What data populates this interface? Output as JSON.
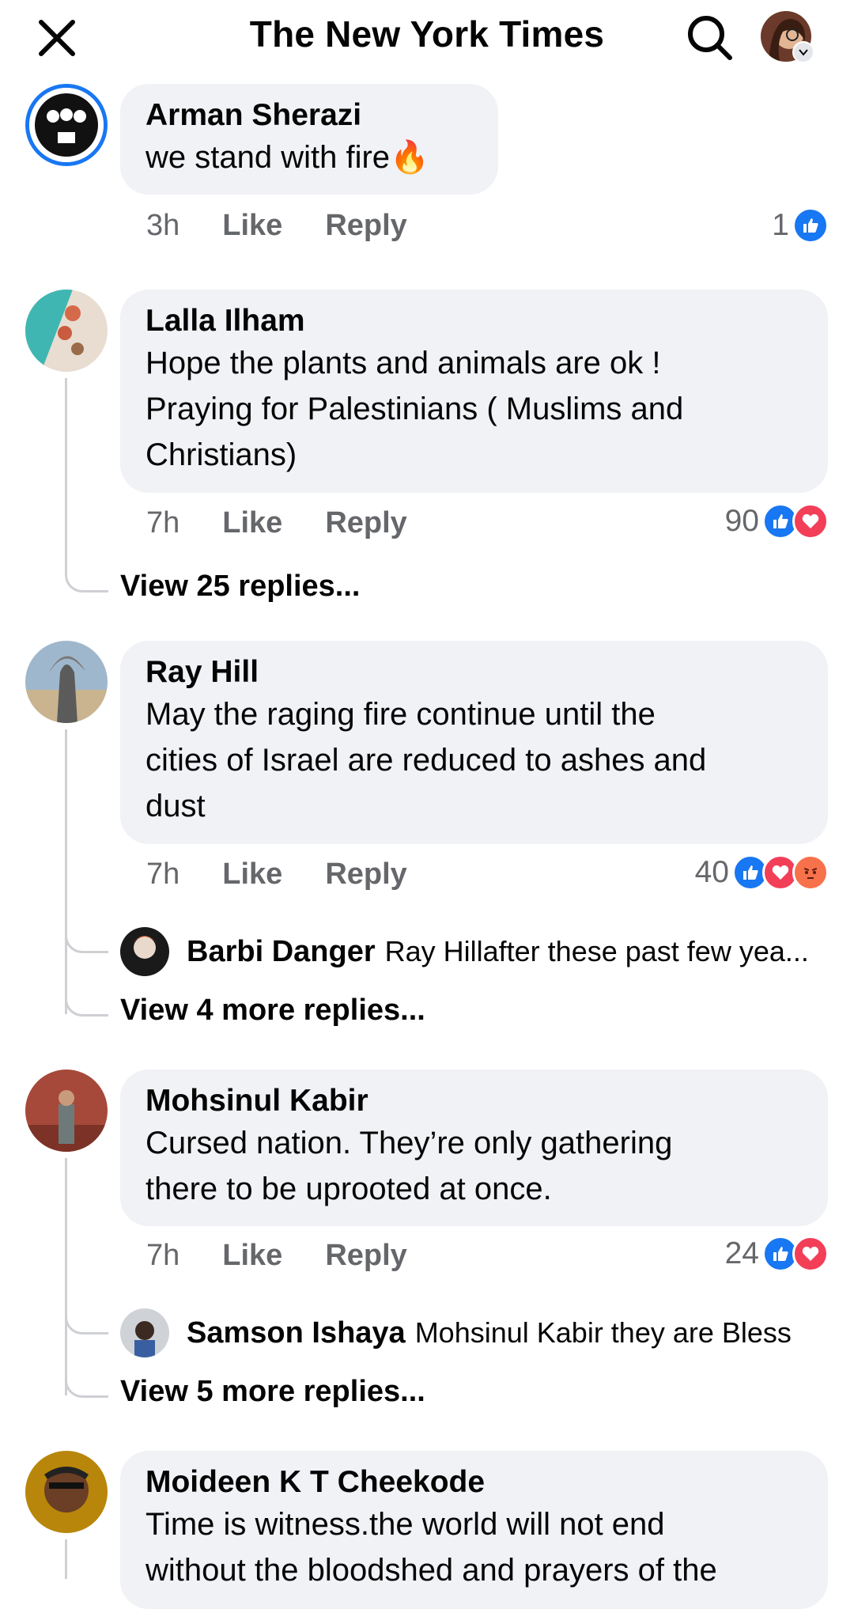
{
  "header": {
    "title": "The New York Times"
  },
  "colors": {
    "like_blue": "#1877f2",
    "love_red": "#f33e58",
    "angry_orange": "#f7714b",
    "bubble_bg": "#f0f2f5",
    "meta_gray": "#65676b"
  },
  "icons": {
    "close": "close-icon",
    "search": "search-icon",
    "profile": "avatar",
    "chevron": "chevron-down-icon"
  },
  "comments": [
    {
      "author": "Arman Sherazi",
      "text": "we stand with fire",
      "emoji": "🔥",
      "time": "3h",
      "like": "Like",
      "reply": "Reply",
      "reaction_count": "1",
      "reactions": [
        "like"
      ]
    },
    {
      "author": "Lalla Ilham",
      "text_lines": [
        "Hope the plants and animals are ok !",
        "Praying for Palestinians ( Muslims and",
        "Christians)"
      ],
      "time": "7h",
      "like": "Like",
      "reply": "Reply",
      "reaction_count": "90",
      "reactions": [
        "like",
        "love"
      ],
      "view_replies": "View 25 replies..."
    },
    {
      "author": "Ray Hill",
      "text_lines": [
        "May the raging fire continue until the",
        "cities of Israel are reduced to ashes and",
        "dust"
      ],
      "time": "7h",
      "like": "Like",
      "reply": "Reply",
      "reaction_count": "40",
      "reactions": [
        "like",
        "love",
        "angry"
      ],
      "reply_preview": {
        "author": "Barbi Danger",
        "text": "Ray Hillafter these past few yea..."
      },
      "view_replies": "View 4 more replies..."
    },
    {
      "author": "Mohsinul Kabir",
      "text_lines": [
        "Cursed nation. They’re only gathering",
        "there to be uprooted at once."
      ],
      "time": "7h",
      "like": "Like",
      "reply": "Reply",
      "reaction_count": "24",
      "reactions": [
        "like",
        "love"
      ],
      "reply_preview": {
        "author": "Samson Ishaya",
        "text": "Mohsinul Kabir they are Bless"
      },
      "view_replies": "View 5 more replies..."
    },
    {
      "author": "Moideen K T Cheekode",
      "text_lines": [
        "Time is witness.the world will not end",
        "without the bloodshed and prayers of the"
      ]
    }
  ]
}
